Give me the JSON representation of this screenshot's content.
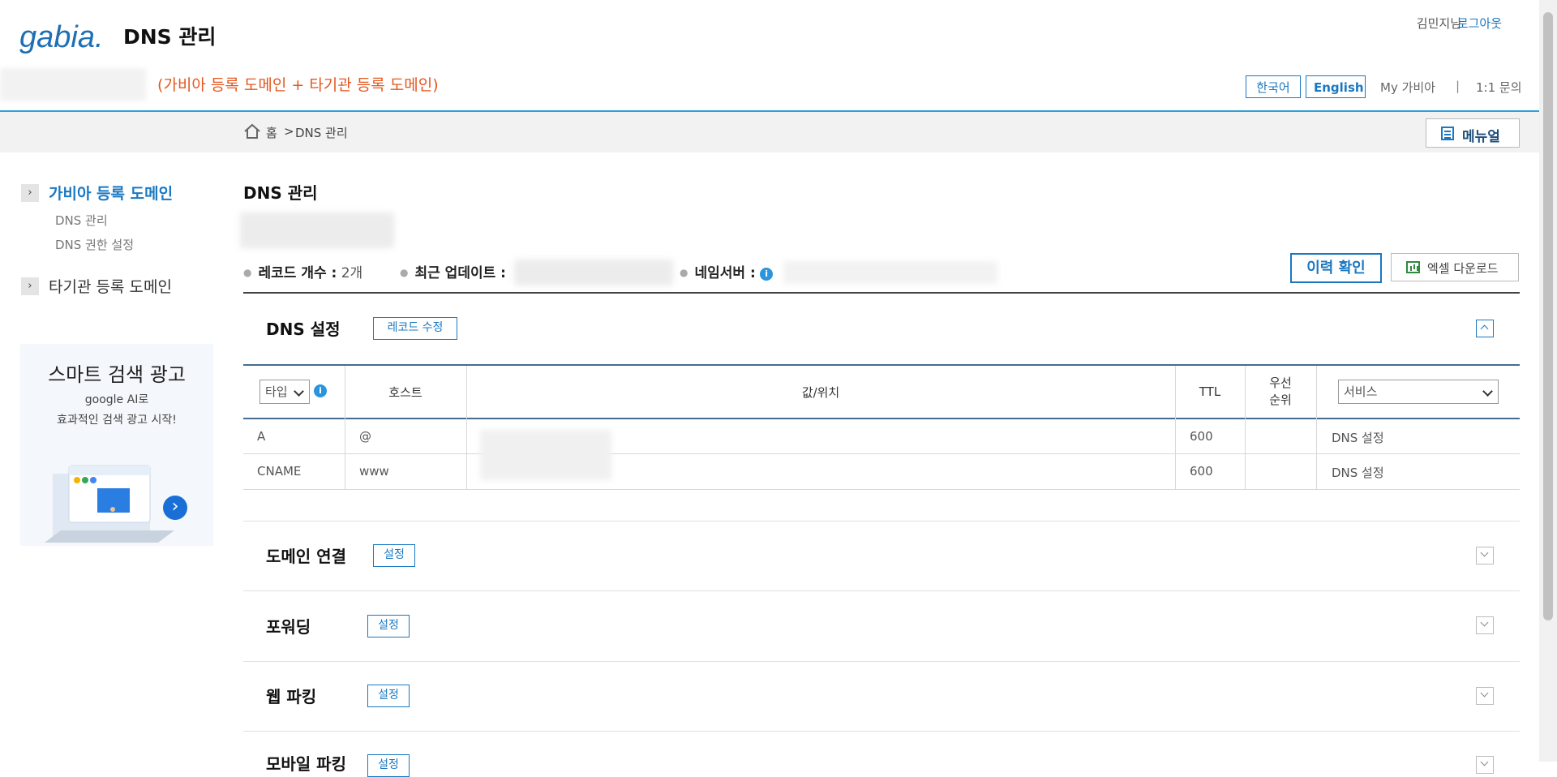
{
  "header": {
    "logo_text": "gabia.",
    "app_title": "DNS 관리",
    "user_name": "김민지님",
    "logout": "로그아웃",
    "domain_note": "(가비아 등록 도메인 + 타기관 등록 도메인)",
    "lang_ko": "한국어",
    "lang_en": "English",
    "my_gabia": "My 가비아",
    "separator": "|",
    "inquiry": "1:1 문의",
    "accent_color": "#1a78c2"
  },
  "breadcrumb": {
    "home": "홈",
    "sep": ">",
    "current": "DNS 관리",
    "manual": "메뉴얼"
  },
  "sidebar": {
    "section1": "가비아 등록 도메인",
    "items": [
      "DNS 관리",
      "DNS 권한 설정"
    ],
    "section2": "타기관 등록 도메인",
    "ad": {
      "title": "스마트 검색 광고",
      "line1": "google AI로",
      "line2": "효과적인 검색 광고 시작!"
    }
  },
  "main": {
    "title": "DNS 관리",
    "meta": {
      "record_count_label": "레코드 개수 :",
      "record_count_value": "2개",
      "last_update_label": "최근 업데이트 :",
      "nameserver_label": "네임서버 :"
    },
    "history_button": "이력 확인",
    "excel_button": "엑셀 다운로드",
    "dns_section": {
      "title": "DNS 설정",
      "edit_button": "레코드 수정",
      "columns": {
        "type_select": "타입",
        "host": "호스트",
        "value": "값/위치",
        "ttl": "TTL",
        "priority": "우선\n순위",
        "service_select": "서비스"
      },
      "rows": [
        {
          "type": "A",
          "host": "@",
          "ttl": "600",
          "priority": "",
          "service": "DNS 설정"
        },
        {
          "type": "CNAME",
          "host": "www",
          "ttl": "600",
          "priority": "",
          "service": "DNS 설정"
        }
      ]
    },
    "sections": [
      {
        "title": "도메인 연결",
        "button": "설정"
      },
      {
        "title": "포워딩",
        "button": "설정"
      },
      {
        "title": "웹 파킹",
        "button": "설정"
      },
      {
        "title": "모바일 파킹",
        "button": "설정"
      }
    ]
  }
}
